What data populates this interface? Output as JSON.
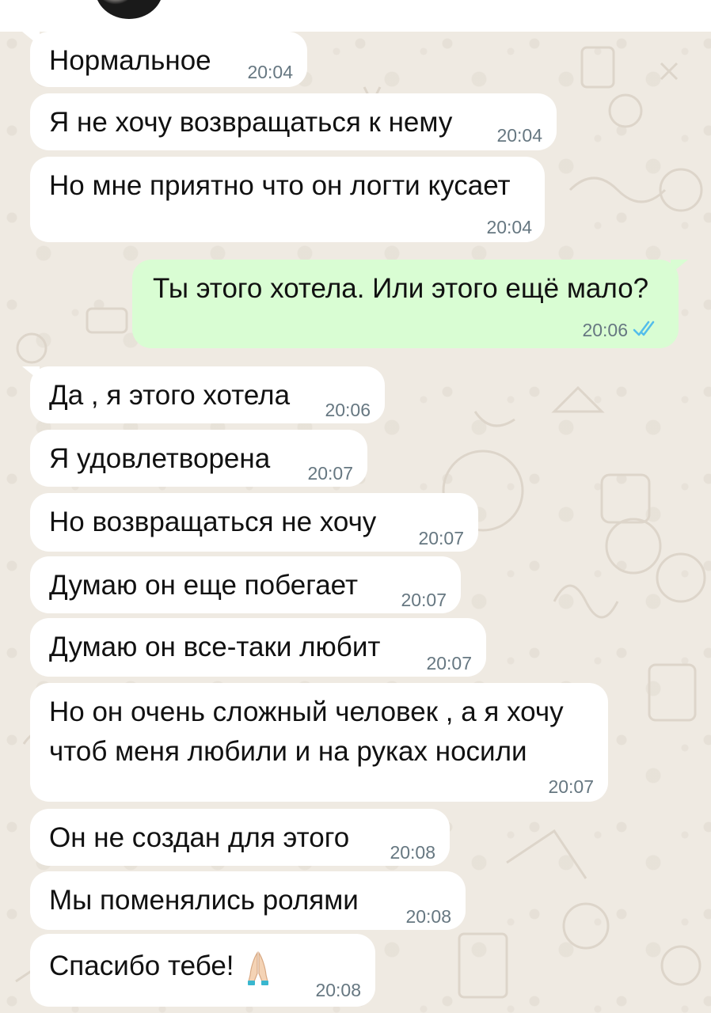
{
  "colors": {
    "incoming_bubble": "#ffffff",
    "outgoing_bubble": "#d9fdd3",
    "timestamp": "#667781",
    "read_ticks": "#53bdeb",
    "wallpaper": "#efeae2"
  },
  "header": {
    "avatar_icon": "contact-avatar"
  },
  "messages": [
    {
      "direction": "incoming",
      "text": "Нормальное",
      "time": "20:04"
    },
    {
      "direction": "incoming",
      "text": "Я не хочу возвращаться к нему",
      "time": "20:04"
    },
    {
      "direction": "incoming",
      "text": "Но мне приятно что он логти кусает",
      "time": "20:04"
    },
    {
      "direction": "outgoing",
      "text": "Ты этого хотела. Или этого ещё мало?",
      "time": "20:06",
      "status_icon": "double-check-read-icon"
    },
    {
      "direction": "incoming",
      "text": "Да , я этого хотела",
      "time": "20:06"
    },
    {
      "direction": "incoming",
      "text": "Я удовлетворена",
      "time": "20:07"
    },
    {
      "direction": "incoming",
      "text": "Но возвращаться не хочу",
      "time": "20:07"
    },
    {
      "direction": "incoming",
      "text": "Думаю он еще побегает",
      "time": "20:07"
    },
    {
      "direction": "incoming",
      "text": "Думаю он все-таки любит",
      "time": "20:07"
    },
    {
      "direction": "incoming",
      "text_lines": [
        "Но он очень сложный человек , а я хочу",
        "чтоб меня любили и на руках носили"
      ],
      "time": "20:07"
    },
    {
      "direction": "incoming",
      "text": "Он не создан для этого",
      "time": "20:08"
    },
    {
      "direction": "incoming",
      "text": "Мы поменялись ролями",
      "time": "20:08"
    },
    {
      "direction": "incoming",
      "text": "Спасибо тебе!",
      "emoji_icon": "folded-hands-emoji",
      "time": "20:08"
    }
  ]
}
